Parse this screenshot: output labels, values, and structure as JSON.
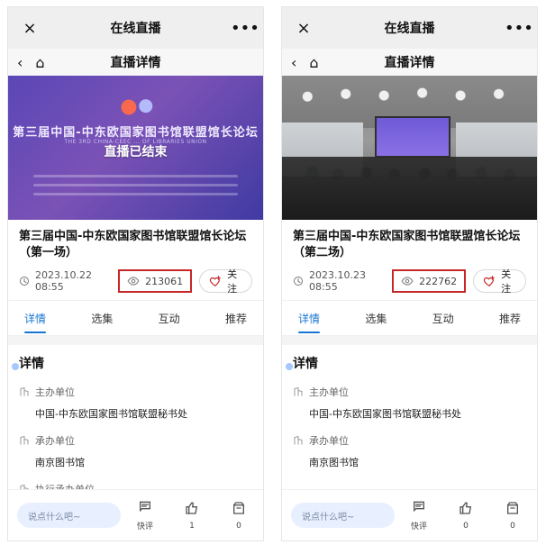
{
  "screens": [
    {
      "titlebar": {
        "close": "×",
        "title": "在线直播",
        "more": "•••"
      },
      "nav": {
        "back": "‹",
        "home": "⌂",
        "title": "直播详情"
      },
      "banner": {
        "event_line": "第三届中国-中东欧国家图书馆联盟馆长论坛",
        "event_sub": "THE 3RD CHINA-CEEC ... OF LIBRARIES UNION",
        "status": "直播已结束"
      },
      "video": {
        "title": "第三届中国-中东欧国家图书馆联盟馆长论坛（第一场）",
        "datetime": "2023.10.22 08:55",
        "views": "213061",
        "follow": "关注"
      },
      "tabs": [
        "详情",
        "选集",
        "互动",
        "推荐"
      ],
      "details": {
        "section": "详情",
        "items": [
          {
            "label": "主办单位",
            "value": "中国-中东欧国家图书馆联盟秘书处"
          },
          {
            "label": "承办单位",
            "value": "南京图书馆"
          },
          {
            "label": "执行承办单位",
            "value": ""
          }
        ]
      },
      "bottom": {
        "comment_placeholder": "说点什么吧~",
        "actions": [
          {
            "name": "快评",
            "count": "快评"
          },
          {
            "name": "like",
            "count": "1"
          },
          {
            "name": "share",
            "count": "0"
          }
        ]
      }
    },
    {
      "titlebar": {
        "close": "×",
        "title": "在线直播",
        "more": "•••"
      },
      "nav": {
        "back": "‹",
        "home": "⌂",
        "title": "直播详情"
      },
      "video": {
        "title": "第三届中国-中东欧国家图书馆联盟馆长论坛（第二场）",
        "datetime": "2023.10.23 08:55",
        "views": "222762",
        "follow": "关注"
      },
      "tabs": [
        "详情",
        "选集",
        "互动",
        "推荐"
      ],
      "details": {
        "section": "详情",
        "items": [
          {
            "label": "主办单位",
            "value": "中国-中东欧国家图书馆联盟秘书处"
          },
          {
            "label": "承办单位",
            "value": "南京图书馆"
          }
        ]
      },
      "bottom": {
        "comment_placeholder": "说点什么吧~",
        "actions": [
          {
            "name": "快评",
            "count": "快评"
          },
          {
            "name": "like",
            "count": "0"
          },
          {
            "name": "share",
            "count": "0"
          }
        ]
      }
    }
  ],
  "colors": {
    "accent": "#1976d2",
    "highlight_border": "#c62828"
  }
}
